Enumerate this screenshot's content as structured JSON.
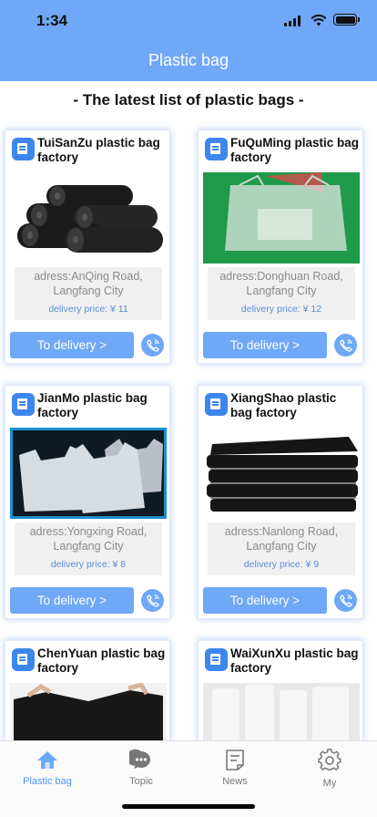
{
  "status_bar": {
    "time": "1:34"
  },
  "header": {
    "title": "Plastic bag"
  },
  "list": {
    "heading": "- The latest list of plastic bags -"
  },
  "colors": {
    "brand": "#6fa8f7",
    "tab_active": "#4f95ef",
    "price_text": "#5b8fd6"
  },
  "factories": [
    {
      "name": "TuiSanZu plastic bag factory",
      "address": "adress:AnQing Road, Langfang City",
      "price": "delivery price: ¥ 11",
      "button": "To delivery >"
    },
    {
      "name": "FuQuMing plastic bag factory",
      "address": "adress:Donghuan Road, Langfang City",
      "price": "delivery price: ¥ 12",
      "button": "To delivery >"
    },
    {
      "name": "JianMo plastic bag factory",
      "address": "adress:Yongxing Road, Langfang City",
      "price": "delivery price: ¥ 8",
      "button": "To delivery >"
    },
    {
      "name": "XiangShao plastic bag factory",
      "address": "adress:Nanlong Road, Langfang City",
      "price": "delivery price: ¥ 9",
      "button": "To delivery >"
    },
    {
      "name": "ChenYuan plastic bag factory"
    },
    {
      "name": "WaiXunXu plastic bag factory"
    }
  ],
  "tabs": [
    {
      "label": "Plastic bag",
      "icon": "home-icon",
      "active": true
    },
    {
      "label": "Topic",
      "icon": "chat-bubble-icon",
      "active": false
    },
    {
      "label": "News",
      "icon": "news-icon",
      "active": false
    },
    {
      "label": "My",
      "icon": "gear-icon",
      "active": false
    }
  ]
}
